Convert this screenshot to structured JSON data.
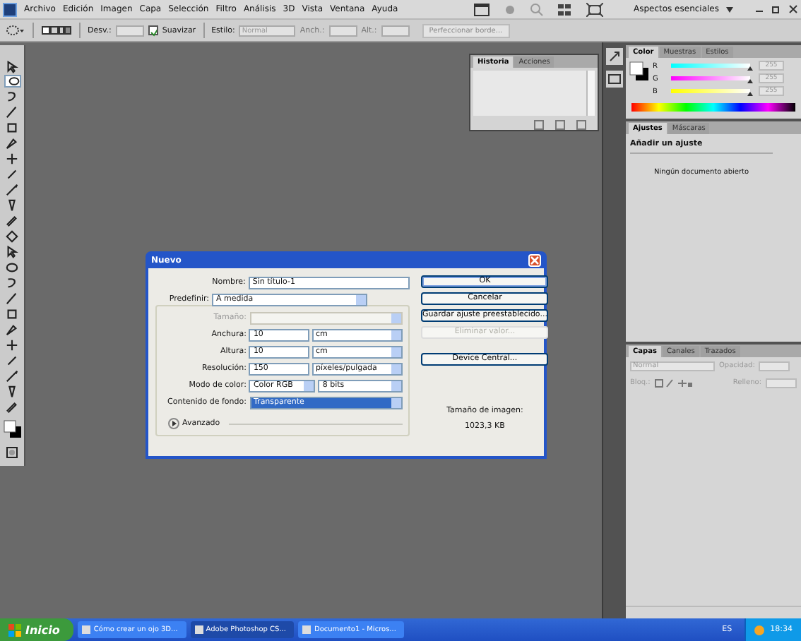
{
  "menu_bar": {
    "items": [
      "Archivo",
      "Edición",
      "Imagen",
      "Capa",
      "Selección",
      "Filtro",
      "Análisis",
      "3D",
      "Vista",
      "Ventana",
      "Ayuda"
    ],
    "workspace": "Aspectos esenciales"
  },
  "options_bar": {
    "feather_label": "Desv.:",
    "antialias": {
      "label": "Suavizar",
      "checked": true
    },
    "style_label": "Estilo:",
    "style_value": "Normal",
    "width_label": "Anch.:",
    "height_label": "Alt.:",
    "refine_button": "Perfeccionar borde..."
  },
  "history_panel": {
    "tabs": [
      {
        "label": "Historia",
        "selected": true
      },
      {
        "label": "Acciones",
        "selected": false
      }
    ]
  },
  "color_panel": {
    "tabs": [
      {
        "label": "Color",
        "selected": true
      },
      {
        "label": "Muestras",
        "selected": false
      },
      {
        "label": "Estilos",
        "selected": false
      }
    ],
    "channels": [
      {
        "name": "R",
        "level": 1,
        "value": "255"
      },
      {
        "name": "G",
        "level": 1,
        "value": "255"
      },
      {
        "name": "B",
        "level": 1,
        "value": "255"
      }
    ]
  },
  "adjustments_panel": {
    "tabs": [
      {
        "label": "Ajustes",
        "selected": true
      },
      {
        "label": "Máscaras",
        "selected": false
      }
    ],
    "heading": "Añadir un ajuste",
    "message": "Ningún documento abierto"
  },
  "layers_panel": {
    "tabs": [
      {
        "label": "Capas",
        "selected": true
      },
      {
        "label": "Canales",
        "selected": false
      },
      {
        "label": "Trazados",
        "selected": false
      }
    ],
    "blend_mode": "Normal",
    "opacity_label": "Opacidad:",
    "lock_label": "Bloq.:",
    "fill_label": "Relleno:"
  },
  "dialog": {
    "title": "Nuevo",
    "name_label": "Nombre:",
    "name_value": "Sin título-1",
    "preset_label": "Predefinir:",
    "preset_value": "A medida",
    "fields": [
      {
        "label": "Tamaño:",
        "kind": "select",
        "disabled": true
      },
      {
        "label": "Anchura:",
        "kind": "number",
        "value": "10",
        "unit": "cm",
        "disabled": false
      },
      {
        "label": "Altura:",
        "kind": "number",
        "value": "10",
        "unit": "cm",
        "disabled": false
      },
      {
        "label": "Resolución:",
        "kind": "number",
        "value": "150",
        "unit": "píxeles/pulgada",
        "disabled": false
      },
      {
        "label": "Modo de color:",
        "kind": "pair",
        "value": "Color RGB",
        "unit": "8 bits",
        "disabled": false
      },
      {
        "label": "Contenido de fondo:",
        "kind": "select",
        "value": "Transparente",
        "selected": true,
        "disabled": false
      }
    ],
    "advanced": {
      "label": "Avanzado",
      "expanded": false
    },
    "buttons": [
      {
        "label": "OK",
        "disabled": false,
        "default": true
      },
      {
        "label": "Cancelar",
        "disabled": false,
        "default": false
      },
      {
        "label": "Guardar ajuste preestablecido...",
        "disabled": false,
        "default": false
      },
      {
        "label": "Eliminar valor...",
        "disabled": true,
        "default": false
      },
      {
        "label": "Device Central...",
        "disabled": false,
        "default": false
      }
    ],
    "size_label": "Tamaño de imagen:",
    "size_value": "1023,3 KB"
  },
  "taskbar": {
    "start": "Inicio",
    "tasks": [
      {
        "label": "Cómo crear un ojo 3D...",
        "selected": false
      },
      {
        "label": "Adobe Photoshop CS...",
        "selected": true
      },
      {
        "label": "Documento1 - Micros...",
        "selected": false
      }
    ],
    "language": "ES",
    "clock": "18:34"
  }
}
